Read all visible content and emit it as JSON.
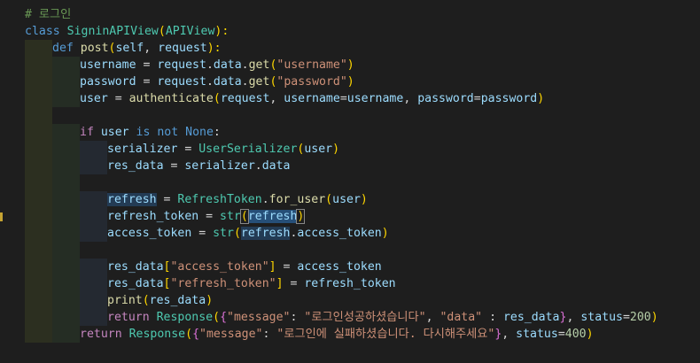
{
  "editor": {
    "lines": [
      [
        {
          "t": "# 로그인",
          "c": "cm"
        }
      ],
      [
        {
          "t": "class ",
          "c": "kw"
        },
        {
          "t": "SigninAPIView",
          "c": "cls"
        },
        {
          "t": "(",
          "c": "brk1"
        },
        {
          "t": "APIView",
          "c": "cls"
        },
        {
          "t": "):",
          "c": "brk1"
        }
      ],
      [
        {
          "t": "def ",
          "c": "kw"
        },
        {
          "t": "post",
          "c": "fn"
        },
        {
          "t": "(",
          "c": "brk1"
        },
        {
          "t": "self",
          "c": "var"
        },
        {
          "t": ", ",
          "c": "plain"
        },
        {
          "t": "request",
          "c": "var"
        },
        {
          "t": "):",
          "c": "brk1"
        }
      ],
      [
        {
          "t": "username",
          "c": "var"
        },
        {
          "t": " = ",
          "c": "plain"
        },
        {
          "t": "request",
          "c": "var"
        },
        {
          "t": ".",
          "c": "plain"
        },
        {
          "t": "data",
          "c": "var"
        },
        {
          "t": ".",
          "c": "plain"
        },
        {
          "t": "get",
          "c": "fn"
        },
        {
          "t": "(",
          "c": "brk1"
        },
        {
          "t": "\"username\"",
          "c": "str"
        },
        {
          "t": ")",
          "c": "brk1"
        }
      ],
      [
        {
          "t": "password",
          "c": "var"
        },
        {
          "t": " = ",
          "c": "plain"
        },
        {
          "t": "request",
          "c": "var"
        },
        {
          "t": ".",
          "c": "plain"
        },
        {
          "t": "data",
          "c": "var"
        },
        {
          "t": ".",
          "c": "plain"
        },
        {
          "t": "get",
          "c": "fn"
        },
        {
          "t": "(",
          "c": "brk1"
        },
        {
          "t": "\"password\"",
          "c": "str"
        },
        {
          "t": ")",
          "c": "brk1"
        }
      ],
      [
        {
          "t": "user",
          "c": "var"
        },
        {
          "t": " = ",
          "c": "plain"
        },
        {
          "t": "authenticate",
          "c": "fn"
        },
        {
          "t": "(",
          "c": "brk1"
        },
        {
          "t": "request",
          "c": "var"
        },
        {
          "t": ", ",
          "c": "plain"
        },
        {
          "t": "username",
          "c": "var"
        },
        {
          "t": "=",
          "c": "plain"
        },
        {
          "t": "username",
          "c": "var"
        },
        {
          "t": ", ",
          "c": "plain"
        },
        {
          "t": "password",
          "c": "var"
        },
        {
          "t": "=",
          "c": "plain"
        },
        {
          "t": "password",
          "c": "var"
        },
        {
          "t": ")",
          "c": "brk1"
        }
      ],
      [],
      [
        {
          "t": "if ",
          "c": "kw2"
        },
        {
          "t": "user",
          "c": "var"
        },
        {
          "t": " is not ",
          "c": "kw"
        },
        {
          "t": "None",
          "c": "kw"
        },
        {
          "t": ":",
          "c": "plain"
        }
      ],
      [
        {
          "t": "serializer",
          "c": "var"
        },
        {
          "t": " = ",
          "c": "plain"
        },
        {
          "t": "UserSerializer",
          "c": "cls"
        },
        {
          "t": "(",
          "c": "brk1"
        },
        {
          "t": "user",
          "c": "var"
        },
        {
          "t": ")",
          "c": "brk1"
        }
      ],
      [
        {
          "t": "res_data",
          "c": "var"
        },
        {
          "t": " = ",
          "c": "plain"
        },
        {
          "t": "serializer",
          "c": "var"
        },
        {
          "t": ".",
          "c": "plain"
        },
        {
          "t": "data",
          "c": "var"
        }
      ],
      [],
      [
        {
          "t": "refresh",
          "c": "var hl2"
        },
        {
          "t": " = ",
          "c": "plain"
        },
        {
          "t": "RefreshToken",
          "c": "cls"
        },
        {
          "t": ".",
          "c": "plain"
        },
        {
          "t": "for_user",
          "c": "fn"
        },
        {
          "t": "(",
          "c": "brk1"
        },
        {
          "t": "user",
          "c": "var"
        },
        {
          "t": ")",
          "c": "brk1"
        }
      ],
      [
        {
          "t": "refresh_token",
          "c": "var"
        },
        {
          "t": " = ",
          "c": "plain"
        },
        {
          "t": "str",
          "c": "cls"
        },
        {
          "t": "(",
          "c": "brk1 cursor-box"
        },
        {
          "t": "refresh",
          "c": "var hl"
        },
        {
          "t": ")",
          "c": "brk1 cursor-box"
        }
      ],
      [
        {
          "t": "access_token",
          "c": "var"
        },
        {
          "t": " = ",
          "c": "plain"
        },
        {
          "t": "str",
          "c": "cls"
        },
        {
          "t": "(",
          "c": "brk1"
        },
        {
          "t": "refresh",
          "c": "var hl2"
        },
        {
          "t": ".",
          "c": "plain"
        },
        {
          "t": "access_token",
          "c": "var"
        },
        {
          "t": ")",
          "c": "brk1"
        }
      ],
      [],
      [
        {
          "t": "res_data",
          "c": "var"
        },
        {
          "t": "[",
          "c": "brk1"
        },
        {
          "t": "\"access_token\"",
          "c": "str"
        },
        {
          "t": "]",
          "c": "brk1"
        },
        {
          "t": " = ",
          "c": "plain"
        },
        {
          "t": "access_token",
          "c": "var"
        }
      ],
      [
        {
          "t": "res_data",
          "c": "var"
        },
        {
          "t": "[",
          "c": "brk1"
        },
        {
          "t": "\"refresh_token\"",
          "c": "str"
        },
        {
          "t": "]",
          "c": "brk1"
        },
        {
          "t": " = ",
          "c": "plain"
        },
        {
          "t": "refresh_token",
          "c": "var"
        }
      ],
      [
        {
          "t": "print",
          "c": "fn"
        },
        {
          "t": "(",
          "c": "brk1"
        },
        {
          "t": "res_data",
          "c": "var"
        },
        {
          "t": ")",
          "c": "brk1"
        }
      ],
      [
        {
          "t": "return ",
          "c": "kw2"
        },
        {
          "t": "Response",
          "c": "cls"
        },
        {
          "t": "(",
          "c": "brk1"
        },
        {
          "t": "{",
          "c": "brk2"
        },
        {
          "t": "\"message\"",
          "c": "str"
        },
        {
          "t": ": ",
          "c": "plain"
        },
        {
          "t": "\"로그인성공하셨습니다\"",
          "c": "str"
        },
        {
          "t": ", ",
          "c": "plain"
        },
        {
          "t": "\"data\"",
          "c": "str"
        },
        {
          "t": " : ",
          "c": "plain"
        },
        {
          "t": "res_data",
          "c": "var"
        },
        {
          "t": "}",
          "c": "brk2"
        },
        {
          "t": ", ",
          "c": "plain"
        },
        {
          "t": "status",
          "c": "var"
        },
        {
          "t": "=",
          "c": "plain"
        },
        {
          "t": "200",
          "c": "num"
        },
        {
          "t": ")",
          "c": "brk1"
        }
      ],
      [
        {
          "t": "return ",
          "c": "kw2"
        },
        {
          "t": "Response",
          "c": "cls"
        },
        {
          "t": "(",
          "c": "brk1"
        },
        {
          "t": "{",
          "c": "brk2"
        },
        {
          "t": "\"message\"",
          "c": "str"
        },
        {
          "t": ": ",
          "c": "plain"
        },
        {
          "t": "\"로그인에 실패하셨습니다. 다시해주세요\"",
          "c": "str"
        },
        {
          "t": "}",
          "c": "brk2"
        },
        {
          "t": ", ",
          "c": "plain"
        },
        {
          "t": "status",
          "c": "var"
        },
        {
          "t": "=",
          "c": "plain"
        },
        {
          "t": "400",
          "c": "num"
        },
        {
          "t": ")",
          "c": "brk1"
        }
      ]
    ]
  }
}
